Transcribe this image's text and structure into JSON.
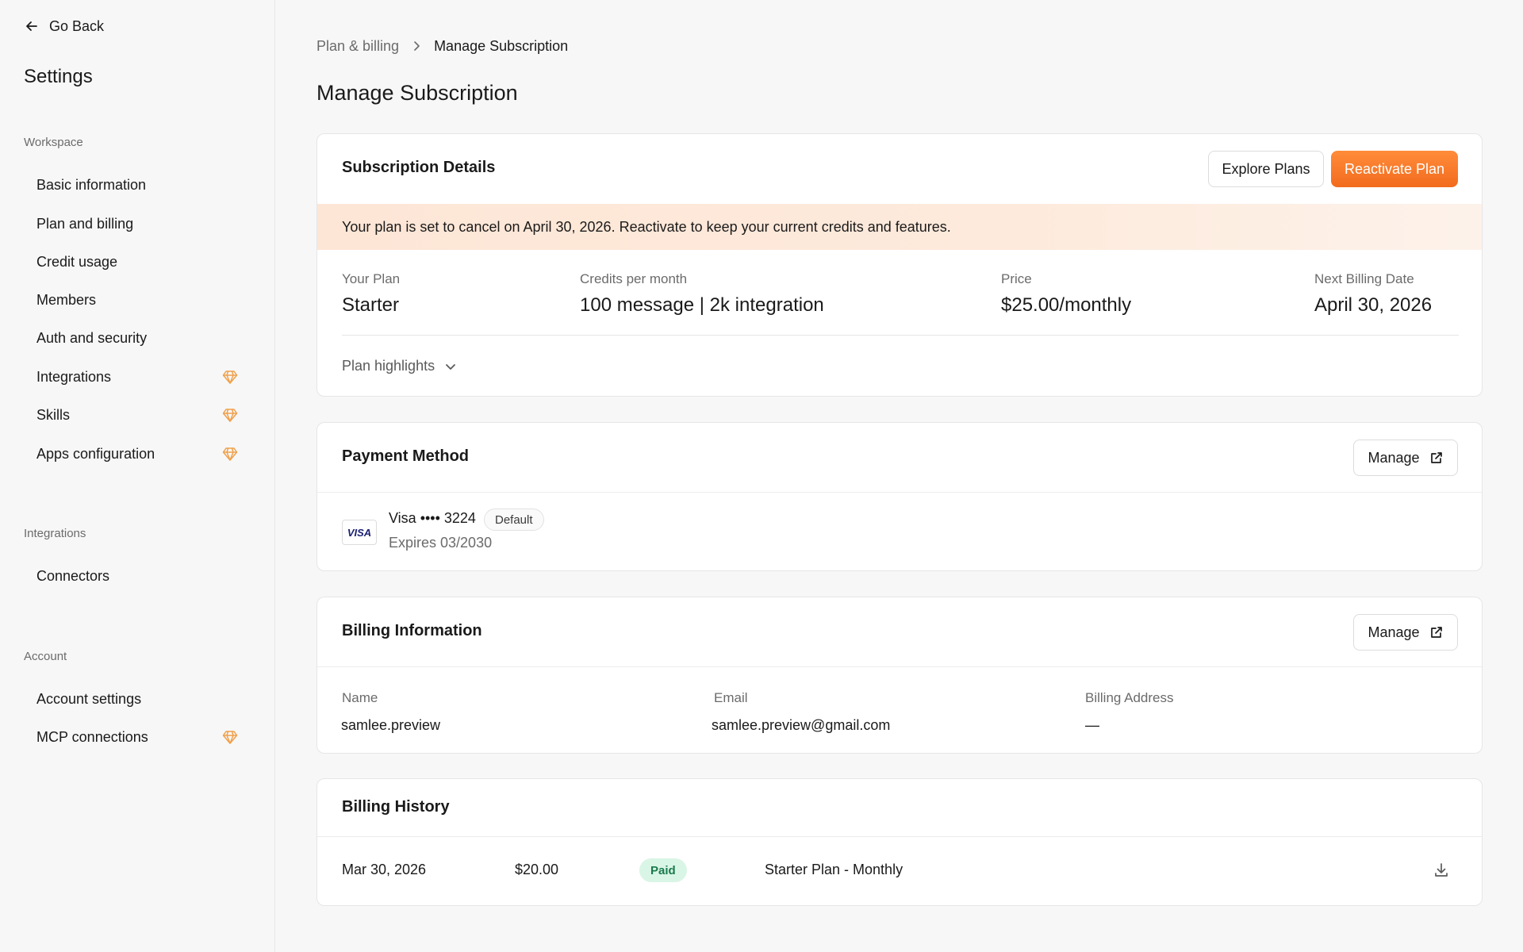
{
  "sidebar": {
    "go_back": "Go Back",
    "title": "Settings",
    "sections": {
      "workspace": "Workspace",
      "integrations": "Integrations",
      "account": "Account"
    },
    "items": [
      {
        "label": "Basic information",
        "premium": false
      },
      {
        "label": "Plan and billing",
        "premium": false
      },
      {
        "label": "Credit usage",
        "premium": false
      },
      {
        "label": "Members",
        "premium": false
      },
      {
        "label": "Auth and security",
        "premium": false
      },
      {
        "label": "Integrations",
        "premium": true
      },
      {
        "label": "Skills",
        "premium": true
      },
      {
        "label": "Apps configuration",
        "premium": true
      },
      {
        "label": "Connectors",
        "premium": false
      },
      {
        "label": "Account settings",
        "premium": false
      },
      {
        "label": "MCP connections",
        "premium": true
      }
    ],
    "premium_icon": "diamond-icon",
    "premium_color": "#f0a04b"
  },
  "breadcrumb": {
    "parent": "Plan & billing",
    "current": "Manage Subscription"
  },
  "page_title": "Manage Subscription",
  "subscription": {
    "title": "Subscription Details",
    "explore_label": "Explore Plans",
    "reactivate_label": "Reactivate Plan",
    "alert": "Your plan is set to cancel on April 30, 2026. Reactivate to keep your current credits and features.",
    "plan_label": "Your Plan",
    "plan_value": "Starter",
    "credits_label": "Credits per month",
    "credits_value": "100 message | 2k integration",
    "price_label": "Price",
    "price_value": "$25.00/monthly",
    "billing_label": "Next Billing Date",
    "billing_value": "April 30, 2026",
    "highlights_label": "Plan highlights"
  },
  "payment": {
    "title": "Payment Method",
    "manage_label": "Manage",
    "card_brand": "VISA",
    "card_number": "Visa •••• 3224",
    "default_label": "Default",
    "expiry": "Expires 03/2030"
  },
  "billing_info": {
    "title": "Billing Information",
    "manage_label": "Manage",
    "name_label": "Name",
    "name_value": "samlee.preview",
    "email_label": "Email",
    "email_value": "samlee.preview@gmail.com",
    "address_label": "Billing Address",
    "address_value": "—"
  },
  "billing_history": {
    "title": "Billing History",
    "rows": [
      {
        "date": "Mar 30, 2026",
        "amount": "$20.00",
        "status": "Paid",
        "description": "Starter Plan - Monthly"
      }
    ]
  },
  "colors": {
    "accent": "#f26b1d",
    "paid_bg": "#d9f5e6",
    "paid_text": "#1a7a4c"
  }
}
